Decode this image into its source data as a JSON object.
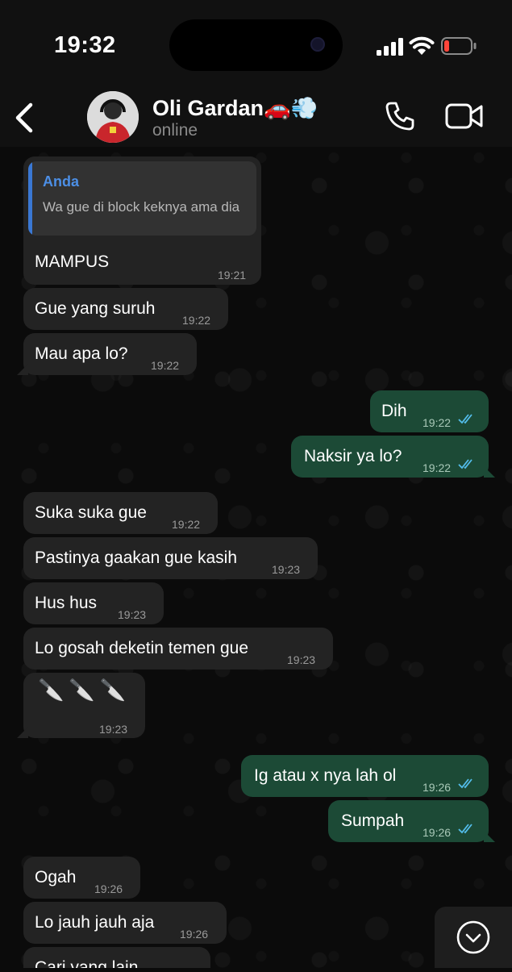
{
  "status_bar": {
    "time": "19:32",
    "battery_color": "#ff453a"
  },
  "header": {
    "back_icon": "chevron-left-icon",
    "contact_name": "Oli Gardan🚗💨",
    "contact_status": "online",
    "call_icon": "phone-icon",
    "video_icon": "video-camera-icon"
  },
  "messages": [
    {
      "dir": "in",
      "quoted_author": "Anda",
      "quoted_text": "Wa gue di block keknya ama dia",
      "text": "MAMPUS",
      "time": "19:21"
    },
    {
      "dir": "in",
      "text": "Gue yang suruh",
      "time": "19:22"
    },
    {
      "dir": "in",
      "text": "Mau apa lo?",
      "time": "19:22"
    },
    {
      "dir": "out",
      "text": "Dih",
      "time": "19:22",
      "status": "read"
    },
    {
      "dir": "out",
      "text": "Naksir ya lo?",
      "time": "19:22",
      "status": "read"
    },
    {
      "dir": "in",
      "text": "Suka suka gue",
      "time": "19:22"
    },
    {
      "dir": "in",
      "text": "Pastinya gaakan gue kasih",
      "time": "19:23"
    },
    {
      "dir": "in",
      "text": "Hus hus",
      "time": "19:23"
    },
    {
      "dir": "in",
      "text": "Lo gosah deketin temen gue",
      "time": "19:23"
    },
    {
      "dir": "in",
      "text": "🔪🔪🔪",
      "time": "19:23"
    },
    {
      "dir": "out",
      "text": "Ig atau x nya lah ol",
      "time": "19:26",
      "status": "read"
    },
    {
      "dir": "out",
      "text": "Sumpah",
      "time": "19:26",
      "status": "read"
    },
    {
      "dir": "in",
      "text": "Ogah",
      "time": "19:26"
    },
    {
      "dir": "in",
      "text": "Lo jauh jauh aja",
      "time": "19:26"
    },
    {
      "dir": "in",
      "text": "Cari yang lain",
      "time": ""
    }
  ],
  "scroll_button_icon": "chevron-down-circle-icon",
  "colors": {
    "incoming_bubble": "#232323",
    "outgoing_bubble": "#1c4a36",
    "read_ticks": "#53bdeb",
    "quote_accent": "#3a78d4"
  }
}
